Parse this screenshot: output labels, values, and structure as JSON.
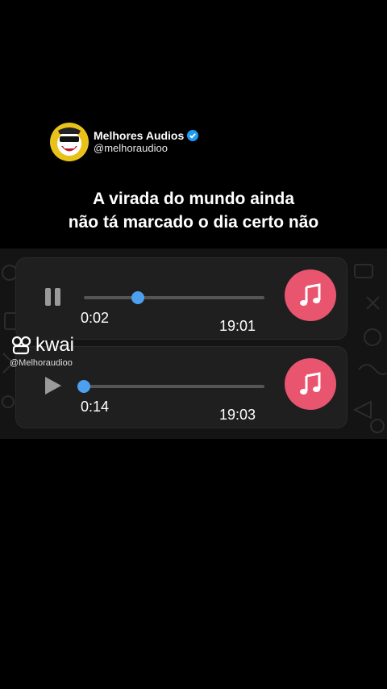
{
  "account": {
    "name": "Melhores Audios",
    "handle": "@melhoraudioo"
  },
  "caption": {
    "line1": "A virada do mundo ainda",
    "line2": "não tá marcado o dia certo não"
  },
  "messages": [
    {
      "state": "pause-icon",
      "elapsed": "0:02",
      "time": "19:01",
      "progress": 0.3
    },
    {
      "state": "play-icon",
      "elapsed": "0:14",
      "time": "19:03",
      "progress": 0.0
    }
  ],
  "watermark": {
    "logo": "kwai",
    "handle": "@Melhoraudioo"
  },
  "colors": {
    "accent_pink": "#e9546f",
    "progress_blue": "#4d9ff0",
    "verified_blue": "#1d9bf0",
    "avatar_yellow": "#e8c21a"
  }
}
